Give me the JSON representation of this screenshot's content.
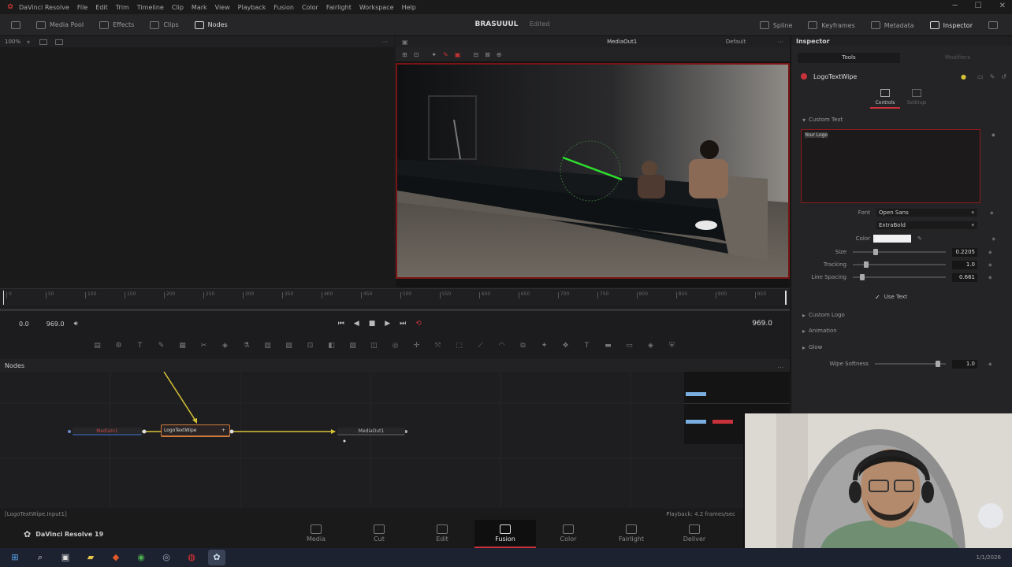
{
  "menu": {
    "app_icon": "resolve-logo-icon",
    "items": [
      "DaVinci Resolve",
      "File",
      "Edit",
      "Trim",
      "Timeline",
      "Clip",
      "Mark",
      "View",
      "Playback",
      "Fusion",
      "Color",
      "Fairlight",
      "Workspace",
      "Help"
    ],
    "window_controls": [
      "─",
      "☐",
      "✕"
    ]
  },
  "toolbar": {
    "media_pool": "Media Pool",
    "effects": "Effects",
    "clips": "Clips",
    "nodes": "Nodes",
    "project_title": "BRASUUUL",
    "project_state": "Edited",
    "spline": "Spline",
    "keyframes": "Keyframes",
    "metadata": "Metadata",
    "inspector": "Inspector"
  },
  "left_viewer": {
    "zoom": "100%"
  },
  "right_viewer": {
    "output": "MediaOut1",
    "lut": "Default"
  },
  "ruler": {
    "ticks": [
      "0",
      "50",
      "100",
      "150",
      "200",
      "250",
      "300",
      "350",
      "400",
      "450",
      "500",
      "550",
      "600",
      "650",
      "700",
      "750",
      "800",
      "850",
      "900",
      "950"
    ]
  },
  "transport": {
    "start": "0.0",
    "end": "969.0",
    "current": "969.0"
  },
  "nodes_panel": {
    "title": "Nodes",
    "menu": "...",
    "nodes": [
      {
        "label": "MediaIn1",
        "color": "#c24a4a"
      },
      {
        "label": "LogoTextWipe",
        "color": "#d07a3a"
      },
      {
        "label": "MediaOut1",
        "color": "#bbbbbb"
      }
    ]
  },
  "status": {
    "left": "[LogoTextWipe.Input1]",
    "right": "Playback: 4.2 frames/sec"
  },
  "inspector": {
    "title": "Inspector",
    "tab_tools": "Tools",
    "tab_modifiers": "Modifiers",
    "node_name": "LogoTextWipe",
    "subtab_controls": "Controls",
    "subtab_settings": "Settings",
    "section_custom_text": "Custom Text",
    "text_value": "Your Logo",
    "font_label": "Font",
    "font_value": "Open Sans",
    "style_value": "ExtraBold",
    "color_label": "Color",
    "size_label": "Size",
    "size_value": "0.2205",
    "tracking_label": "Tracking",
    "tracking_value": "1.0",
    "linespacing_label": "Line Spacing",
    "linespacing_value": "0.661",
    "use_text": "Use Text",
    "section_custom_logo": "Custom Logo",
    "section_animation": "Animation",
    "section_glow": "Glow",
    "wipe_softness_label": "Wipe Softness",
    "wipe_softness_value": "1.0",
    "size_fraction": 0.22,
    "tracking_fraction": 0.12,
    "linespacing_fraction": 0.08,
    "wipe_fraction": 0.85
  },
  "pages": [
    {
      "label": "Media",
      "icon": "media-page-icon"
    },
    {
      "label": "Cut",
      "icon": "cut-page-icon"
    },
    {
      "label": "Edit",
      "icon": "edit-page-icon"
    },
    {
      "label": "Fusion",
      "icon": "fusion-page-icon"
    },
    {
      "label": "Color",
      "icon": "color-page-icon"
    },
    {
      "label": "Fairlight",
      "icon": "fairlight-page-icon"
    },
    {
      "label": "Deliver",
      "icon": "deliver-page-icon"
    }
  ],
  "resolve_brand": "DaVinci Resolve 19",
  "taskbar": {
    "clock": "1/1/2026"
  },
  "colors": {
    "accent_red": "#c8323a",
    "connection_yellow": "#d6c236",
    "active_node_orange": "#d07a3a"
  }
}
